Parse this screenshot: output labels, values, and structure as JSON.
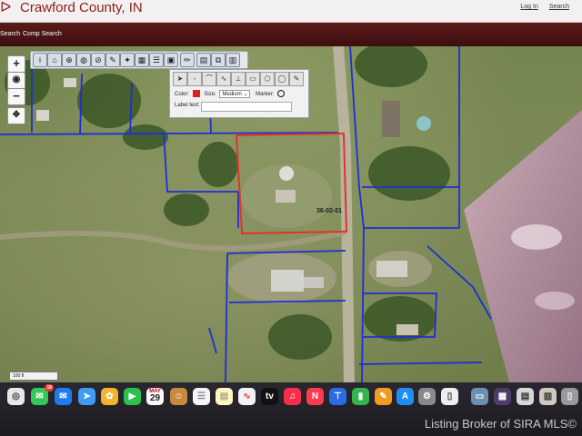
{
  "header": {
    "title": "Crawford County, IN",
    "links": [
      "Log In",
      "Search"
    ]
  },
  "nav": {
    "items": [
      "Search",
      "Comp Search"
    ]
  },
  "map": {
    "zoom_in": "+",
    "zoom_out": "−",
    "parcel_label": "36-02-01",
    "scale_label": "100 ft",
    "selected_parcel_color": "#e0342b",
    "boundary_color": "#1c2fd6"
  },
  "toolbar": {
    "tools": [
      "info-icon",
      "home-icon",
      "zoom-area-icon",
      "identify-icon",
      "measure-icon",
      "draw-icon",
      "buffer-icon",
      "select-icon",
      "layers-icon",
      "print-icon",
      "pencil-icon",
      "markup-icon",
      "copy-icon",
      "export-icon",
      "save-icon"
    ]
  },
  "draw_panel": {
    "color_label": "Color:",
    "color_value": "#e21f1f",
    "size_label": "Size:",
    "size_value": "Medium",
    "marker_label": "Marker:",
    "label_text_label": "Label text:",
    "label_text_value": ""
  },
  "dock": {
    "calendar_month": "MAY",
    "calendar_day": "29",
    "messages_badge": "18"
  },
  "watermark": "Listing Broker of SIRA MLS©"
}
